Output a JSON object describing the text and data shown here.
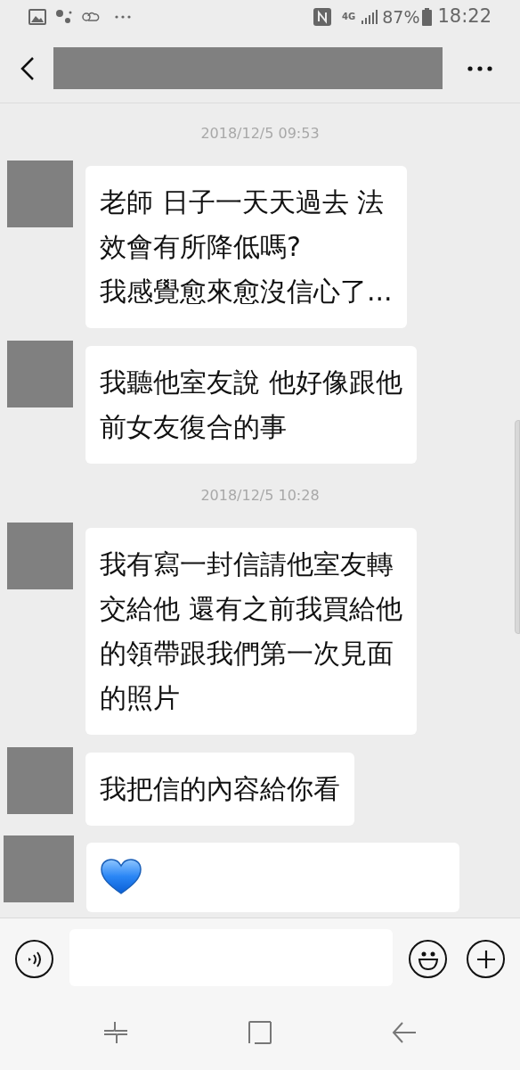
{
  "status_bar": {
    "network": "4G",
    "battery": "87%",
    "time": "18:22"
  },
  "messages": [
    {
      "kind": "timestamp",
      "text": "2018/12/5 09:53"
    },
    {
      "kind": "text",
      "lines": [
        "老師 日子一天天過去 法",
        "效會有所降低嗎?",
        "我感覺愈來愈沒信心了..."
      ]
    },
    {
      "kind": "text",
      "lines": [
        "我聽他室友說 他好像跟他",
        "前女友復合的事"
      ]
    },
    {
      "kind": "timestamp",
      "text": "2018/12/5 10:28"
    },
    {
      "kind": "text",
      "lines": [
        "我有寫一封信請他室友轉",
        "交給他 還有之前我買給他",
        "的領帶跟我們第一次見面",
        "的照片"
      ]
    },
    {
      "kind": "text",
      "lines": [
        "我把信的內容給你看"
      ]
    },
    {
      "kind": "heart"
    }
  ]
}
